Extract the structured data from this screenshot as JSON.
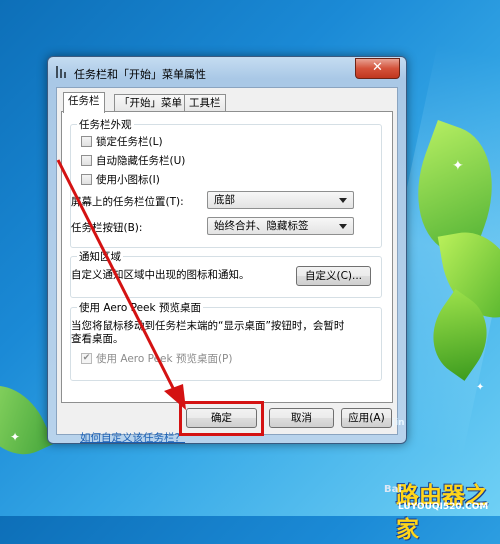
{
  "window": {
    "title": "任务栏和「开始」菜单属性",
    "close_glyph": "✕"
  },
  "tabs": [
    {
      "label": "任务栏",
      "active": true
    },
    {
      "label": "「开始」菜单",
      "active": false
    },
    {
      "label": "工具栏",
      "active": false
    }
  ],
  "appearance": {
    "group_title": "任务栏外观",
    "lock_taskbar": {
      "label": "锁定任务栏(L)",
      "checked": false
    },
    "auto_hide": {
      "label": "自动隐藏任务栏(U)",
      "checked": false
    },
    "small_icons": {
      "label": "使用小图标(I)",
      "checked": false
    },
    "location": {
      "label": "屏幕上的任务栏位置(T):",
      "value": "底部"
    },
    "buttons": {
      "label": "任务栏按钮(B):",
      "value": "始终合并、隐藏标签"
    }
  },
  "notification": {
    "group_title": "通知区域",
    "description": "自定义通知区域中出现的图标和通知。",
    "customize_label": "自定义(C)..."
  },
  "aero_peek": {
    "group_title": "使用 Aero Peek 预览桌面",
    "description_line1": "当您将鼠标移动到任务栏末端的“显示桌面”按钮时，会暂时",
    "description_line2": "查看桌面。",
    "checkbox": {
      "label": "使用 Aero Peek 预览桌面(P)",
      "checked": true,
      "enabled": false
    }
  },
  "help_link": "如何自定义该任务栏？",
  "footer": {
    "ok_label": "确定",
    "cancel_label": "取消",
    "apply_label": "应用(A)"
  },
  "watermarks": {
    "site_name": "路由器之家",
    "site_url": "LUYOUQI520.COM",
    "partial_url": "jin",
    "baidu_text": "Bai"
  },
  "colors": {
    "annotation_red": "#d41212",
    "link_blue": "#1a5fb4",
    "close_red": "#c0371f"
  }
}
